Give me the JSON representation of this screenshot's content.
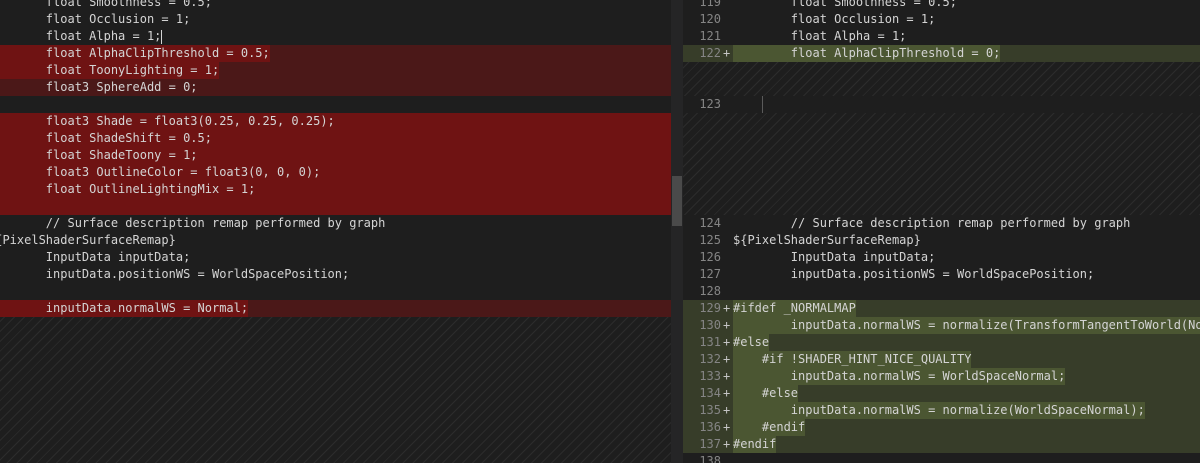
{
  "colors": {
    "deleted_line": "#4b1818",
    "deleted_text": "#6f1313",
    "inserted_line": "#373d29",
    "inserted_text": "#4b5632",
    "background": "#1e1e1e",
    "line_number": "#858585"
  },
  "left_lines": [
    "        float Smoothness = 0.5;",
    "        float Occlusion = 1;",
    "        float Alpha = 1;",
    "        float AlphaClipThreshold = 0.5;",
    "        float ToonyLighting = 1;",
    "        float3 SphereAdd = 0;",
    "",
    "        float3 Shade = float3(0.25, 0.25, 0.25);",
    "        float ShadeShift = 0.5;",
    "        float ShadeToony = 1;",
    "        float3 OutlineColor = float3(0, 0, 0);",
    "        float OutlineLightingMix = 1;",
    "",
    "        // Surface description remap performed by graph",
    "${PixelShaderSurfaceRemap}",
    "        InputData inputData;",
    "        inputData.positionWS = WorldSpacePosition;",
    "",
    "        inputData.normalWS = Normal;"
  ],
  "right_lines": [
    {
      "num": "119",
      "mark": "",
      "text": "        float Smoothness = 0.5;"
    },
    {
      "num": "120",
      "mark": "",
      "text": "        float Occlusion = 1;"
    },
    {
      "num": "121",
      "mark": "",
      "text": "        float Alpha = 1;"
    },
    {
      "num": "122",
      "mark": "+",
      "text": "        float AlphaClipThreshold = 0;"
    },
    {
      "num": "123",
      "mark": "",
      "text": ""
    },
    {
      "num": "124",
      "mark": "",
      "text": "        // Surface description remap performed by graph"
    },
    {
      "num": "125",
      "mark": "",
      "text": "${PixelShaderSurfaceRemap}"
    },
    {
      "num": "126",
      "mark": "",
      "text": "        InputData inputData;"
    },
    {
      "num": "127",
      "mark": "",
      "text": "        inputData.positionWS = WorldSpacePosition;"
    },
    {
      "num": "128",
      "mark": "",
      "text": ""
    },
    {
      "num": "129",
      "mark": "+",
      "text": "#ifdef _NORMALMAP"
    },
    {
      "num": "130",
      "mark": "+",
      "text": "        inputData.normalWS = normalize(TransformTangentToWorld(NormalTS"
    },
    {
      "num": "131",
      "mark": "+",
      "text": "#else"
    },
    {
      "num": "132",
      "mark": "+",
      "text": "    #if !SHADER_HINT_NICE_QUALITY"
    },
    {
      "num": "133",
      "mark": "+",
      "text": "        inputData.normalWS = WorldSpaceNormal;"
    },
    {
      "num": "134",
      "mark": "+",
      "text": "    #else"
    },
    {
      "num": "135",
      "mark": "+",
      "text": "        inputData.normalWS = normalize(WorldSpaceNormal);"
    },
    {
      "num": "136",
      "mark": "+",
      "text": "    #endif"
    },
    {
      "num": "137",
      "mark": "+",
      "text": "#endif"
    },
    {
      "num": "138",
      "mark": "",
      "text": ""
    }
  ]
}
